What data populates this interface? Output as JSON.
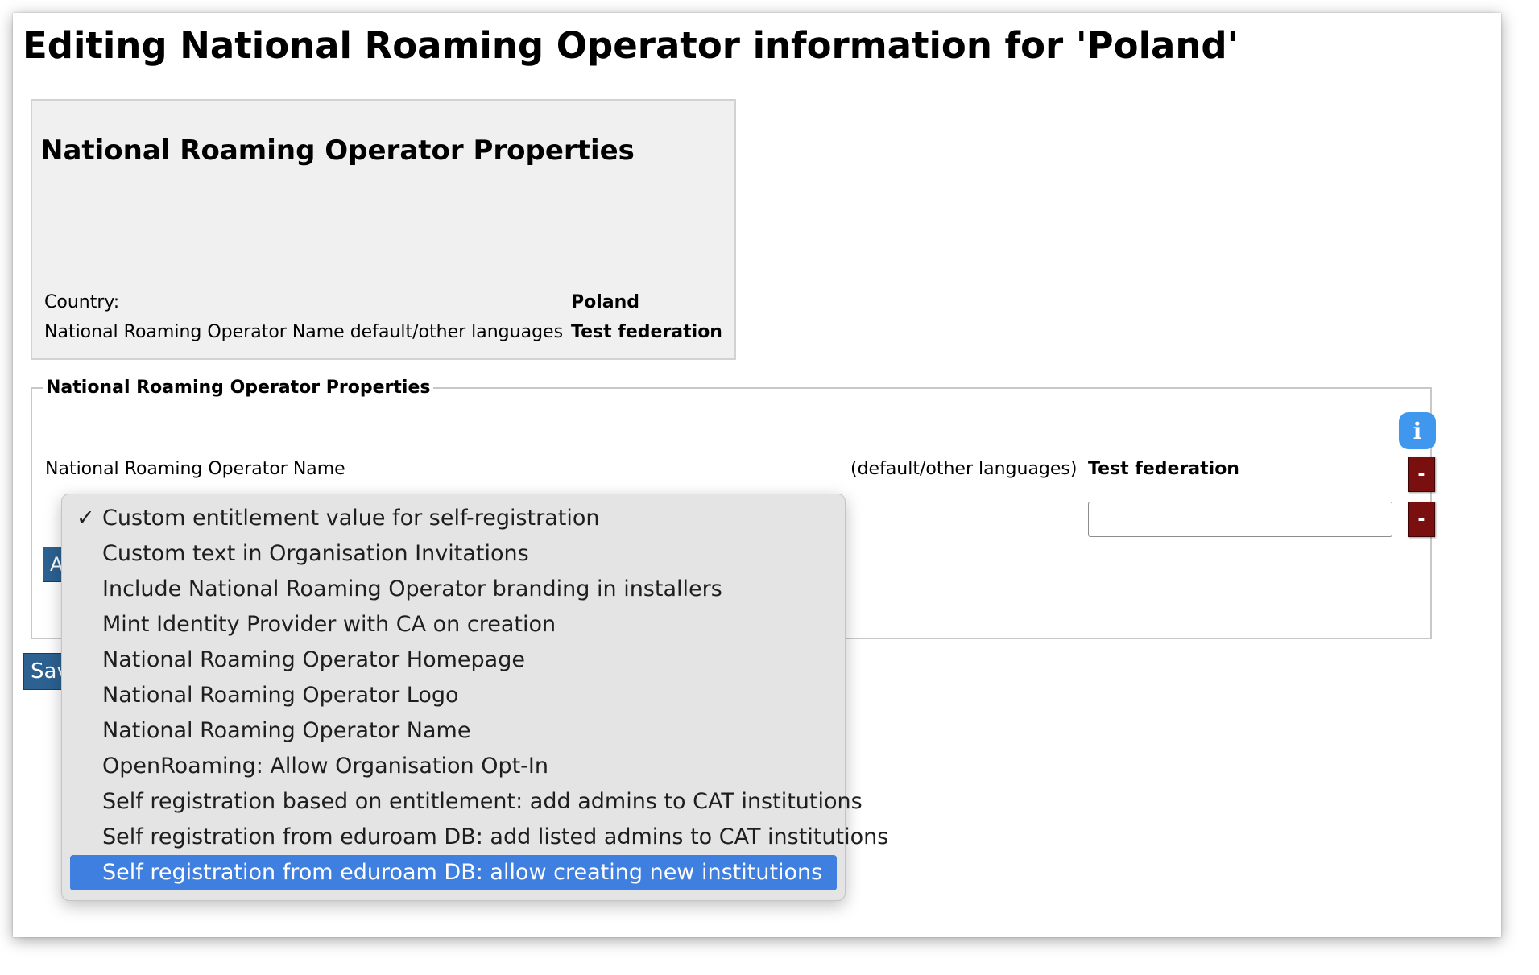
{
  "page": {
    "title": "Editing National Roaming Operator information for 'Poland'"
  },
  "summary": {
    "heading": "National Roaming Operator Properties",
    "rows": [
      {
        "label": "Country:",
        "value": "Poland"
      },
      {
        "label": "National Roaming Operator Name default/other languages",
        "value": "Test federation"
      }
    ]
  },
  "form": {
    "legend": "National Roaming Operator Properties",
    "info_icon": "i",
    "name_row": {
      "label": "National Roaming Operator Name",
      "lang": "(default/other languages)",
      "value": "Test federation"
    },
    "new_value_input": "",
    "remove_label": "-",
    "add_button_label": "A",
    "save_button_label": "Sav"
  },
  "dropdown": {
    "checkmark": "✓",
    "checked_index": 0,
    "highlighted_index": 10,
    "options": [
      "Custom entitlement value for self-registration",
      "Custom text in Organisation Invitations",
      "Include National Roaming Operator branding in installers",
      "Mint Identity Provider with CA on creation",
      "National Roaming Operator Homepage",
      "National Roaming Operator Logo",
      "National Roaming Operator Name",
      "OpenRoaming: Allow Organisation Opt-In",
      "Self registration based on entitlement: add admins to CAT institutions",
      "Self registration from eduroam DB: add listed admins to CAT institutions",
      "Self registration from eduroam DB: allow creating new institutions"
    ]
  },
  "colors": {
    "primary_button": "#2c6191",
    "remove_button": "#7a0f0f",
    "info_button": "#3f98ee",
    "dropdown_highlight": "#3f7fe0"
  }
}
